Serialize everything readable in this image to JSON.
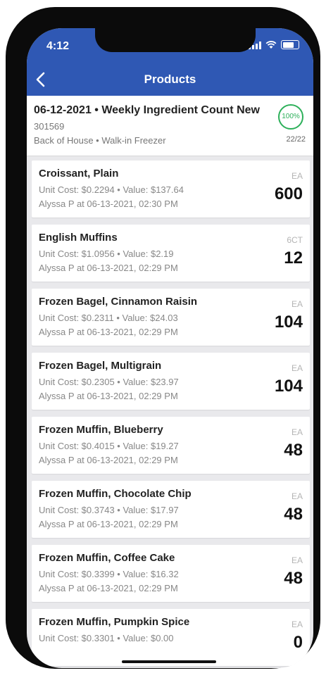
{
  "status": {
    "time": "4:12"
  },
  "header": {
    "title": "Products"
  },
  "summary": {
    "title": "06-12-2021 • Weekly Ingredient Count New",
    "id": "301569",
    "location": "Back of House • Walk-in Freezer",
    "percent": "100%",
    "count": "22/22"
  },
  "items": [
    {
      "name": "Croissant, Plain",
      "cost": "Unit Cost: $0.2294 • Value: $137.64",
      "by": "Alyssa P at 06-13-2021, 02:30 PM",
      "unit": "EA",
      "qty": "600"
    },
    {
      "name": "English Muffins",
      "cost": "Unit Cost: $1.0956 • Value: $2.19",
      "by": "Alyssa P at 06-13-2021, 02:29 PM",
      "unit": "6CT",
      "qty": "12"
    },
    {
      "name": "Frozen Bagel, Cinnamon Raisin",
      "cost": "Unit Cost: $0.2311 • Value: $24.03",
      "by": "Alyssa P at 06-13-2021, 02:29 PM",
      "unit": "EA",
      "qty": "104"
    },
    {
      "name": "Frozen Bagel, Multigrain",
      "cost": "Unit Cost: $0.2305 • Value: $23.97",
      "by": "Alyssa P at 06-13-2021, 02:29 PM",
      "unit": "EA",
      "qty": "104"
    },
    {
      "name": "Frozen Muffin, Blueberry",
      "cost": "Unit Cost: $0.4015 • Value: $19.27",
      "by": "Alyssa P at 06-13-2021, 02:29 PM",
      "unit": "EA",
      "qty": "48"
    },
    {
      "name": "Frozen Muffin, Chocolate Chip",
      "cost": "Unit Cost: $0.3743 • Value: $17.97",
      "by": "Alyssa P at 06-13-2021, 02:29 PM",
      "unit": "EA",
      "qty": "48"
    },
    {
      "name": "Frozen Muffin, Coffee Cake",
      "cost": "Unit Cost: $0.3399 • Value: $16.32",
      "by": "Alyssa P at 06-13-2021, 02:29 PM",
      "unit": "EA",
      "qty": "48"
    },
    {
      "name": "Frozen Muffin, Pumpkin Spice",
      "cost": "Unit Cost: $0.3301 • Value: $0.00",
      "by": "",
      "unit": "EA",
      "qty": "0"
    }
  ],
  "colors": {
    "accent": "#2f58b4",
    "complete": "#2db05a"
  },
  "icons": {
    "back": "chevron-left-icon"
  }
}
